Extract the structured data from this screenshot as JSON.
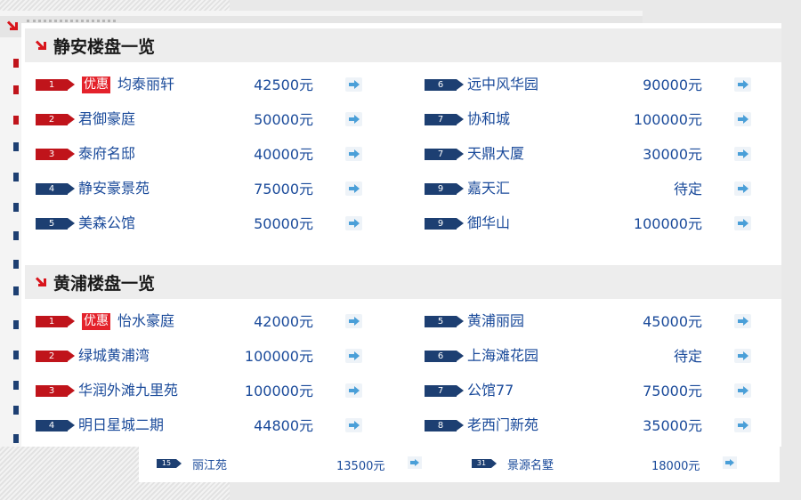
{
  "colors": {
    "accent_red": "#c0141b",
    "badge_blue": "#1d3f72",
    "link_blue": "#1a4a9a",
    "promo_red": "#e4222b",
    "go_arrow": "#4a9fd8"
  },
  "sections": [
    {
      "title": "静安楼盘一览",
      "rows": [
        {
          "rank": "1",
          "promo": "优惠",
          "name": "均泰丽轩",
          "price": "42500元",
          "color": "red"
        },
        {
          "rank": "2",
          "promo": "",
          "name": "君御豪庭",
          "price": "50000元",
          "color": "red"
        },
        {
          "rank": "3",
          "promo": "",
          "name": "泰府名邸",
          "price": "40000元",
          "color": "red"
        },
        {
          "rank": "4",
          "promo": "",
          "name": "静安豪景苑",
          "price": "75000元",
          "color": "blue"
        },
        {
          "rank": "5",
          "promo": "",
          "name": "美森公馆",
          "price": "50000元",
          "color": "blue"
        },
        {
          "rank": "6",
          "promo": "",
          "name": "远中风华园",
          "price": "90000元",
          "color": "blue"
        },
        {
          "rank": "7",
          "promo": "",
          "name": "协和城",
          "price": "100000元",
          "color": "blue"
        },
        {
          "rank": "7",
          "promo": "",
          "name": "天鼎大厦",
          "price": "30000元",
          "color": "blue"
        },
        {
          "rank": "9",
          "promo": "",
          "name": "嘉天汇",
          "price": "待定",
          "color": "blue"
        },
        {
          "rank": "9",
          "promo": "",
          "name": "御华山",
          "price": "100000元",
          "color": "blue"
        }
      ]
    },
    {
      "title": "黄浦楼盘一览",
      "rows": [
        {
          "rank": "1",
          "promo": "优惠",
          "name": "怡水豪庭",
          "price": "42000元",
          "color": "red"
        },
        {
          "rank": "2",
          "promo": "",
          "name": "绿城黄浦湾",
          "price": "100000元",
          "color": "red"
        },
        {
          "rank": "3",
          "promo": "",
          "name": "华润外滩九里苑",
          "price": "100000元",
          "color": "red"
        },
        {
          "rank": "4",
          "promo": "",
          "name": "明日星城二期",
          "price": "44800元",
          "color": "blue"
        },
        {
          "rank": "5",
          "promo": "",
          "name": "黄浦丽园",
          "price": "45000元",
          "color": "blue"
        },
        {
          "rank": "6",
          "promo": "",
          "name": "上海滩花园",
          "price": "待定",
          "color": "blue"
        },
        {
          "rank": "7",
          "promo": "",
          "name": "公馆77",
          "price": "75000元",
          "color": "blue"
        },
        {
          "rank": "8",
          "promo": "",
          "name": "老西门新苑",
          "price": "35000元",
          "color": "blue"
        }
      ]
    }
  ],
  "bottom_rows": [
    {
      "rank": "15",
      "name": "丽江苑",
      "price": "13500元"
    },
    {
      "rank": "31",
      "name": "景源名墅",
      "price": "18000元"
    }
  ]
}
